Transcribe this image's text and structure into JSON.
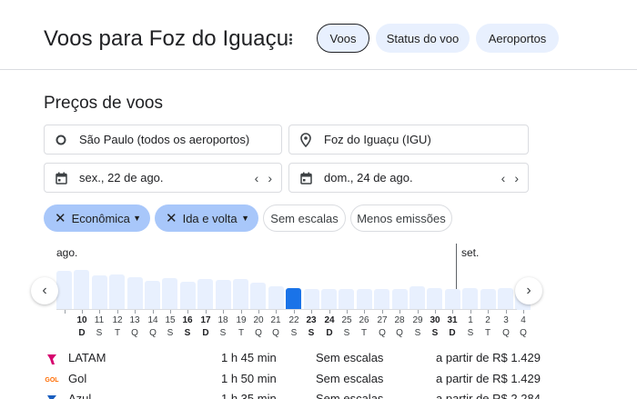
{
  "header": {
    "title": "Voos para Foz do Iguaçu",
    "tabs": [
      {
        "label": "Voos",
        "active": true
      },
      {
        "label": "Status do voo",
        "active": false
      },
      {
        "label": "Aeroportos",
        "active": false
      }
    ]
  },
  "search": {
    "section_title": "Preços de voos",
    "origin": "São Paulo (todos os aeroportos)",
    "destination": "Foz do Iguaçu (IGU)",
    "depart_date": "sex., 22 de ago.",
    "return_date": "dom., 24 de ago."
  },
  "filters": {
    "class": "Econômica",
    "trip_type": "Ida e volta",
    "nonstop": "Sem escalas",
    "emissions": "Menos emissões"
  },
  "calendar": {
    "month_start": "ago.",
    "month_next": "set.",
    "days": [
      {
        "num": "",
        "letter": "",
        "level": 0.72,
        "weekend": false
      },
      {
        "num": "10",
        "letter": "D",
        "level": 0.74,
        "weekend": true
      },
      {
        "num": "11",
        "letter": "S",
        "level": 0.64,
        "weekend": false
      },
      {
        "num": "12",
        "letter": "T",
        "level": 0.65,
        "weekend": false
      },
      {
        "num": "13",
        "letter": "Q",
        "level": 0.6,
        "weekend": false
      },
      {
        "num": "14",
        "letter": "Q",
        "level": 0.54,
        "weekend": false
      },
      {
        "num": "15",
        "letter": "S",
        "level": 0.58,
        "weekend": false
      },
      {
        "num": "16",
        "letter": "S",
        "level": 0.52,
        "weekend": true
      },
      {
        "num": "17",
        "letter": "D",
        "level": 0.56,
        "weekend": true
      },
      {
        "num": "18",
        "letter": "S",
        "level": 0.55,
        "weekend": false
      },
      {
        "num": "19",
        "letter": "T",
        "level": 0.57,
        "weekend": false
      },
      {
        "num": "20",
        "letter": "Q",
        "level": 0.5,
        "weekend": false
      },
      {
        "num": "21",
        "letter": "Q",
        "level": 0.44,
        "weekend": false
      },
      {
        "num": "22",
        "letter": "S",
        "level": 0.4,
        "weekend": false,
        "selected": true
      },
      {
        "num": "23",
        "letter": "S",
        "level": 0.39,
        "weekend": true
      },
      {
        "num": "24",
        "letter": "D",
        "level": 0.38,
        "weekend": true
      },
      {
        "num": "25",
        "letter": "S",
        "level": 0.38,
        "weekend": false
      },
      {
        "num": "26",
        "letter": "T",
        "level": 0.38,
        "weekend": false
      },
      {
        "num": "27",
        "letter": "Q",
        "level": 0.39,
        "weekend": false
      },
      {
        "num": "28",
        "letter": "Q",
        "level": 0.39,
        "weekend": false
      },
      {
        "num": "29",
        "letter": "S",
        "level": 0.44,
        "weekend": false
      },
      {
        "num": "30",
        "letter": "S",
        "level": 0.4,
        "weekend": true
      },
      {
        "num": "31",
        "letter": "D",
        "level": 0.38,
        "weekend": true
      },
      {
        "num": "1",
        "letter": "S",
        "level": 0.4,
        "weekend": false
      },
      {
        "num": "2",
        "letter": "T",
        "level": 0.38,
        "weekend": false
      },
      {
        "num": "3",
        "letter": "Q",
        "level": 0.4,
        "weekend": false
      },
      {
        "num": "4",
        "letter": "Q",
        "level": 0.4,
        "weekend": false
      }
    ]
  },
  "flights": [
    {
      "airline": "LATAM",
      "duration": "1 h 45 min",
      "stops": "Sem escalas",
      "price_prefix": "a partir de",
      "price": "R$ 1.429",
      "logo_color": "#d6006e"
    },
    {
      "airline": "Gol",
      "duration": "1 h 50 min",
      "stops": "Sem escalas",
      "price_prefix": "a partir de",
      "price": "R$ 1.429",
      "logo_color": "#ff6b00",
      "logo_text": "GOL"
    },
    {
      "airline": "Azul",
      "duration": "1 h 35 min",
      "stops": "Sem escalas",
      "price_prefix": "a partir de",
      "price": "R$ 2.284",
      "logo_color": "#1a5ebf"
    }
  ],
  "icons": {
    "menu": "more-vert-icon",
    "origin": "circle-outline-icon",
    "destination": "map-pin-icon",
    "calendar": "calendar-icon",
    "prev": "chevron-left-icon",
    "next": "chevron-right-icon",
    "close": "close-icon",
    "dropdown": "caret-down-icon"
  },
  "colors": {
    "accent": "#1a73e8",
    "chip_filled": "#a8c7fa",
    "bar": "#e8f0fe"
  }
}
